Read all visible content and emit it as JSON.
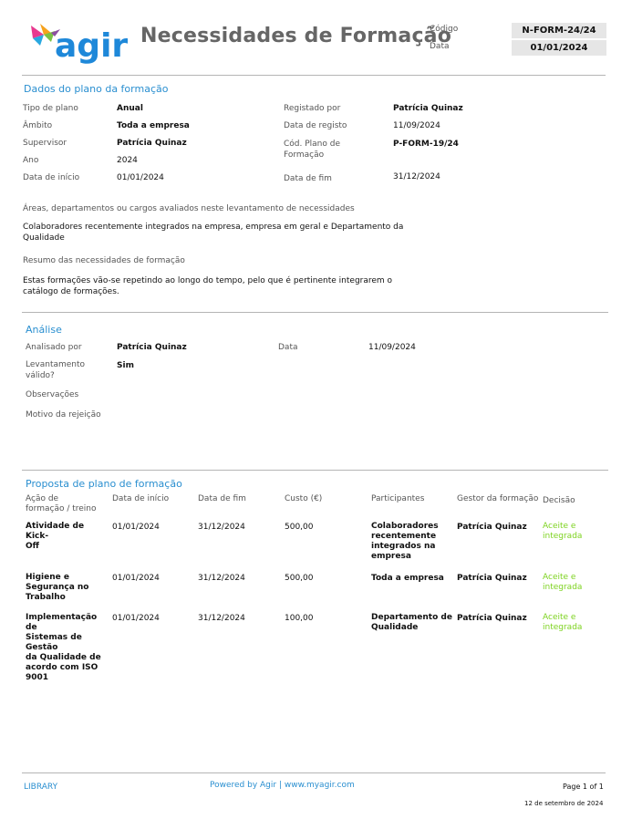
{
  "header": {
    "logo_text": "agir",
    "title": "Necessidades de Formação",
    "code_label": "Código",
    "code_value": "N-FORM-24/24",
    "date_label": "Data",
    "date_value": "01/01/2024"
  },
  "plan": {
    "section_title": "Dados do plano da formação",
    "tipo_label": "Tipo de plano",
    "tipo_value": "Anual",
    "ambito_label": "Âmbito",
    "ambito_value": "Toda a empresa",
    "supervisor_label": "Supervisor",
    "supervisor_value": "Patrícia Quinaz",
    "ano_label": "Ano",
    "ano_value": "2024",
    "inicio_label": "Data de início",
    "inicio_value": "01/01/2024",
    "registado_label": "Registado por",
    "registado_value": "Patrícia Quinaz",
    "data_registo_label": "Data de registo",
    "data_registo_value": "11/09/2024",
    "cod_plano_label_1": "Cód. Plano de",
    "cod_plano_label_2": "Formação",
    "cod_plano_value": "P-FORM-19/24",
    "fim_label": "Data de fim",
    "fim_value": "31/12/2024",
    "areas_label": "Áreas, departamentos ou cargos avaliados neste levantamento de necessidades",
    "areas_value_1": "Colaboradores recentemente integrados na empresa, empresa em geral e Departamento da",
    "areas_value_2": "Qualidade",
    "resumo_label": "Resumo das necessidades de formação",
    "resumo_value_1": "Estas formações vão-se repetindo ao longo do tempo, pelo que é pertinente integrarem o",
    "resumo_value_2": "catálogo de formações."
  },
  "analise": {
    "section_title": "Análise",
    "analisado_label": "Analisado por",
    "analisado_value": "Patrícia Quinaz",
    "data_label": "Data",
    "data_value": "11/09/2024",
    "valido_label_1": "Levantamento",
    "valido_label_2": "válido?",
    "valido_value": "Sim",
    "obs_label": "Observações",
    "motivo_label": "Motivo da rejeição"
  },
  "proposta": {
    "section_title": "Proposta de plano de formação",
    "headers": {
      "acao_1": "Ação de",
      "acao_2": "formação / treino",
      "inicio": "Data de início",
      "fim": "Data de fim",
      "custo": "Custo (€)",
      "participantes": "Participantes",
      "gestor": "Gestor da formação",
      "decisao": "Decisão"
    },
    "rows": [
      {
        "acao": [
          "Atividade de Kick-",
          "Off"
        ],
        "inicio": "01/01/2024",
        "fim": "31/12/2024",
        "custo": "500,00",
        "participantes": [
          "Colaboradores",
          "recentemente",
          "integrados na",
          "empresa"
        ],
        "gestor": "Patrícia Quinaz",
        "decisao": [
          "Aceite e",
          "integrada"
        ]
      },
      {
        "acao": [
          "Higiene e",
          "Segurança no",
          "Trabalho"
        ],
        "inicio": "01/01/2024",
        "fim": "31/12/2024",
        "custo": "500,00",
        "participantes": [
          "Toda a empresa"
        ],
        "gestor": "Patrícia Quinaz",
        "decisao": [
          "Aceite e",
          "integrada"
        ]
      },
      {
        "acao": [
          "Implementação de",
          "Sistemas de Gestão",
          "da Qualidade de",
          "acordo com ISO",
          "9001"
        ],
        "inicio": "01/01/2024",
        "fim": "31/12/2024",
        "custo": "100,00",
        "participantes": [
          "Departamento de",
          "Qualidade"
        ],
        "gestor": "Patrícia Quinaz",
        "decisao": [
          "Aceite e",
          "integrada"
        ]
      }
    ]
  },
  "footer": {
    "library": "LIBRARY",
    "powered": "Powered by Agir | www.myagir.com",
    "page": "Page 1 of 1",
    "date": "12 de setembro de 2024"
  },
  "colors": {
    "accent": "#2a8fd0",
    "green": "#7ed321",
    "title_gray": "#666666"
  }
}
